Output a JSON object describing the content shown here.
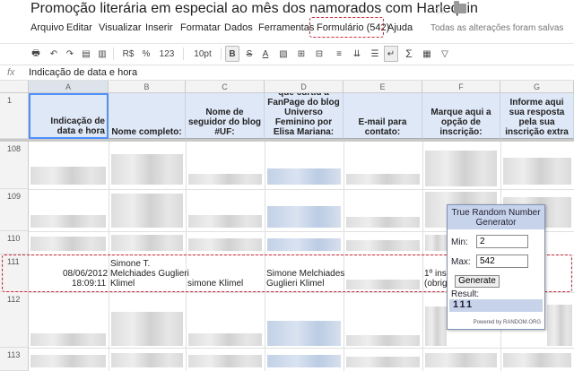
{
  "doc": {
    "title": "Promoção literária em especial ao mês dos namorados com Harlequin"
  },
  "menu": {
    "items": [
      "Arquivo",
      "Editar",
      "Visualizar",
      "Inserir",
      "Formatar",
      "Dados",
      "Ferramentas",
      "Formulário (542)",
      "Ajuda"
    ],
    "saved_status": "Todas as alterações foram salvas"
  },
  "toolbar": {
    "currency": "R$",
    "percent": "%",
    "number_format": "123",
    "font_size": "10pt",
    "bold": "B",
    "text_color": "A",
    "sum": "Σ"
  },
  "formula_bar": {
    "fx": "fx",
    "value": "Indicação de data e hora"
  },
  "columns": [
    "A",
    "B",
    "C",
    "D",
    "E",
    "F",
    "G"
  ],
  "header_row": {
    "num": "1",
    "cells": [
      "Indicação de data e hora",
      "Nome completo:",
      "Nome de seguidor do blog #UF:",
      "Link do perfil que curtiu a FanPage do blog Universo Feminino por Elisa Mariana:",
      "E-mail para contato:",
      "Marque aqui a opção de inscrição:",
      "Informe aqui sua resposta pela sua inscrição extra"
    ]
  },
  "rows": [
    {
      "num": "108"
    },
    {
      "num": "109"
    },
    {
      "num": "110"
    },
    {
      "num": "111",
      "timestamp_date": "08/06/2012",
      "timestamp_time": "18:09:11",
      "name_1": "Simone T.",
      "name_2": "Melchiades Guglieri",
      "name_3": "Klimel",
      "follower": "simone Klimel",
      "profile_1": "Simone Melchiades",
      "profile_2": "Guglieri Klimel",
      "option_1": "1º ins",
      "option_2": "(obrig"
    },
    {
      "num": "112"
    },
    {
      "num": "113"
    }
  ],
  "rng_widget": {
    "title_1": "True Random Number",
    "title_2": "Generator",
    "min_label": "Min:",
    "min_value": "2",
    "max_label": "Max:",
    "max_value": "542",
    "generate_label": "Generate",
    "result_label": "Result:",
    "result_value": "111",
    "powered_by": "Powered by RANDOM.ORG"
  }
}
